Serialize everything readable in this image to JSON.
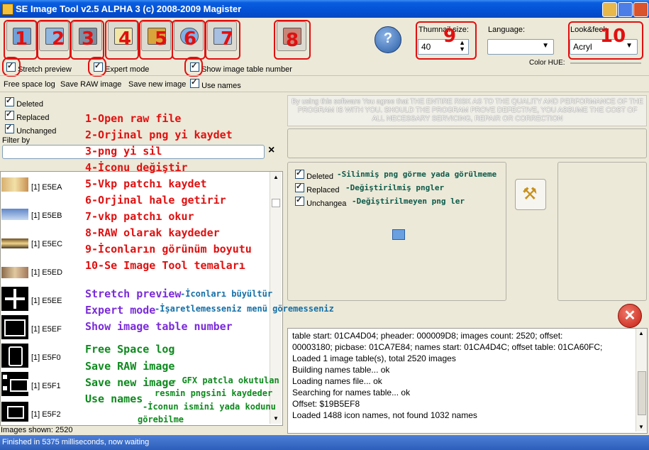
{
  "window": {
    "title": "SE Image Tool v2.5 ALPHA 3 (c) 2008-2009 Magister"
  },
  "toolbar": {
    "buttons": [
      {
        "num": "1",
        "icon": "open-folder-icon"
      },
      {
        "num": "2",
        "icon": "save-png-icon"
      },
      {
        "num": "3",
        "icon": "delete-png-icon"
      },
      {
        "num": "4",
        "icon": "change-icon-icon"
      },
      {
        "num": "5",
        "icon": "save-vkp-icon"
      },
      {
        "num": "6",
        "icon": "restore-icon"
      },
      {
        "num": "7",
        "icon": "read-vkp-icon"
      },
      {
        "num": "8",
        "icon": "save-raw-icon"
      }
    ],
    "help_icon": "help-icon",
    "thumbnail": {
      "label": "Thumnail size:",
      "value": "40",
      "num": "9"
    },
    "language": {
      "label": "Language:",
      "value": ""
    },
    "lookfeel": {
      "label": "Look&feel:",
      "value": "Acryl",
      "num": "10"
    },
    "color_hue": "Color HUE:"
  },
  "options": {
    "stretch_preview": "Stretch preview",
    "expert_mode": "Expert mode",
    "show_table_number": "Show image table number",
    "free_space_log": "Free space log",
    "save_raw_image": "Save RAW image",
    "save_new_image": "Save new image",
    "use_names": "Use names"
  },
  "filters": {
    "deleted": "Deleted",
    "replaced": "Replaced",
    "unchanged": "Unchanged",
    "filter_by": "Filter by",
    "clear": "×"
  },
  "images": [
    {
      "label": "[1] E5EA"
    },
    {
      "label": "[1] E5EB"
    },
    {
      "label": "[1] E5EC"
    },
    {
      "label": "[1] E5ED"
    },
    {
      "label": "[1] E5EE"
    },
    {
      "label": "[1] E5EF"
    },
    {
      "label": "[1] E5F0"
    },
    {
      "label": "[1] E5F1"
    },
    {
      "label": "[1] E5F2"
    }
  ],
  "images_shown": "Images shown: 2520",
  "disclaimer": "By using this software You agree that THE ENTIRE RISK AS TO THE QUALITY AND PERFORMANCE OF THE PROGRAM IS WITH YOU. SHOULD THE PROGRAM PROVE DEFECTIVE, YOU ASSUME THE COST OF ALL NECESSARY SERVICING, REPAIR OR CORRECTION",
  "right_filters": {
    "deleted": "Deleted",
    "replaced": "Replaced",
    "unchanged": "Unchangea"
  },
  "log": [
    "table start: 01CA4D04; pheader: 000009D8; images count: 2520; offset:",
    "00003180; picbase: 01CA7E84; names start: 01CA4D4C; offset table: 01CA60FC;",
    "Loaded 1 image table(s), total 2520 images",
    "Building names table... ok",
    "Loading names file... ok",
    "Searching for names table... ok",
    "Offset: $19B5EF8",
    "Loaded 1488 icon names, not found 1032 names"
  ],
  "status": "Finished in 5375 milliseconds, now waiting",
  "annotations": {
    "red": [
      "1-Open raw file",
      "2-Orjinal png yi kaydet",
      "3-png yi sil",
      "4-İconu değiştir",
      "5-Vkp patchı kaydet",
      "6-Orjinal hale getirir",
      "7-vkp patchı okur",
      "8-RAW olarak kaydeder",
      "9-İconların görünüm boyutu",
      "10-Se Image Tool temaları"
    ],
    "stretch": "Stretch preview",
    "stretch_note": "-İconları büyültür",
    "expert": "Expert mode",
    "expert_note": "-İşaretlemesseniz menü göremesseniz",
    "show_table": "Show image table number",
    "free_space": "Free Space log",
    "save_raw": "Save RAW image",
    "save_new": "Save new image",
    "save_new_note1": "- GFX patcla okutulan",
    "save_new_note2": "resmin pngsini  kaydeder",
    "use_names": "Use names",
    "use_names_note1": "-İconun ismini yada kodunu",
    "use_names_note2": "görebilme",
    "deleted_note": "-Silinmiş png görme yada görülmeme",
    "replaced_note": "-Değiştirilmiş pngler",
    "unchanged_note": "-Değiştirilmeyen png ler"
  }
}
